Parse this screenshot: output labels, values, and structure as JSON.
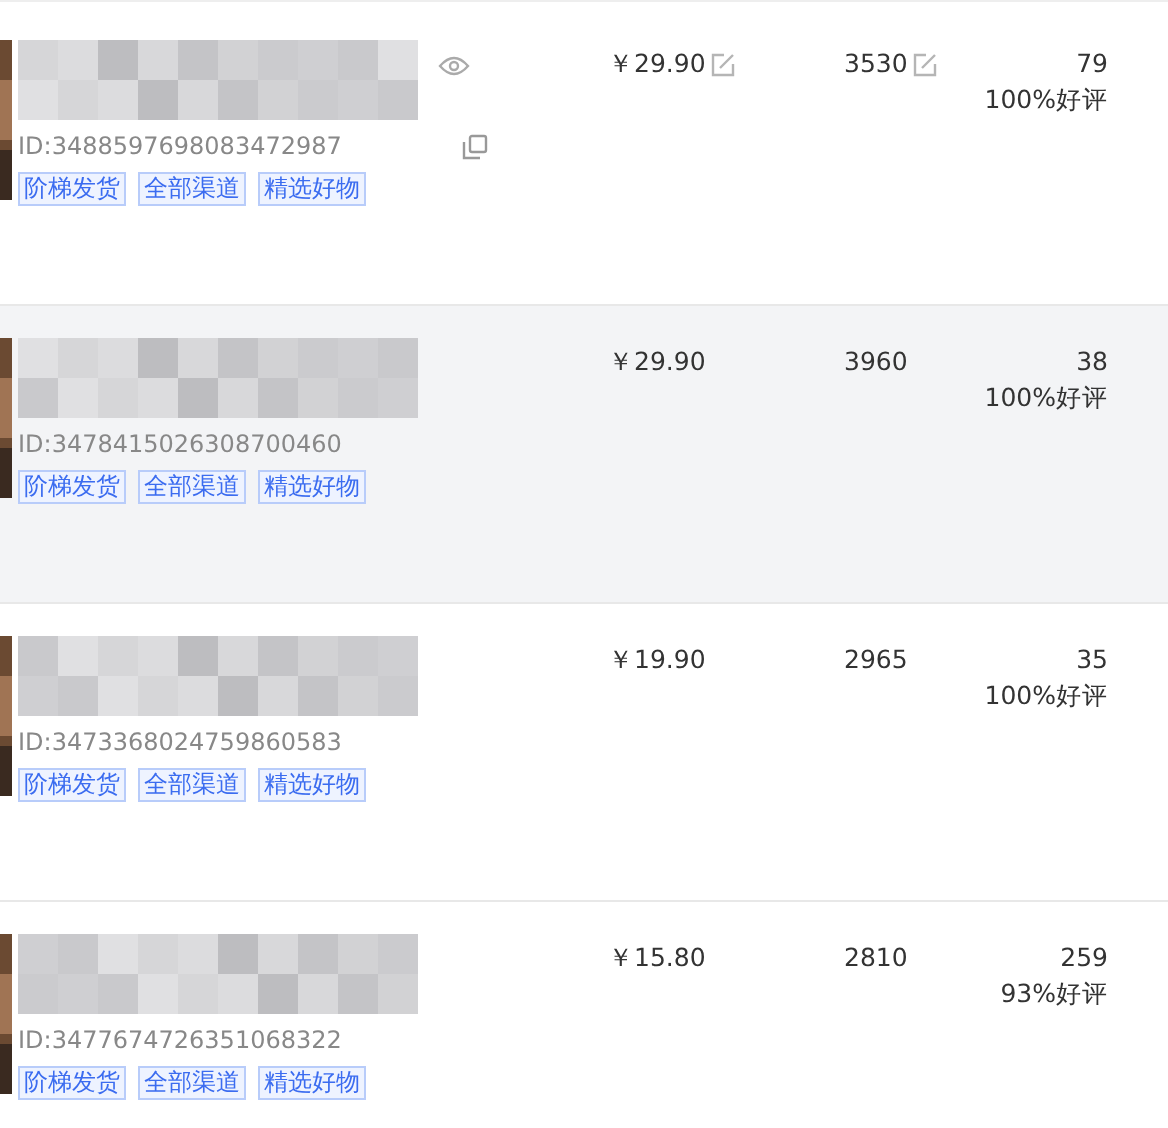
{
  "products": [
    {
      "highlighted": false,
      "editable": true,
      "id": "ID:3488597698083472987",
      "tags": [
        "阶梯发货",
        "全部渠道",
        "精选好物"
      ],
      "price": "￥29.90",
      "stock": "3530",
      "reviews": "79",
      "rating": "100%好评"
    },
    {
      "highlighted": true,
      "editable": false,
      "id": "ID:3478415026308700460",
      "tags": [
        "阶梯发货",
        "全部渠道",
        "精选好物"
      ],
      "price": "￥29.90",
      "stock": "3960",
      "reviews": "38",
      "rating": "100%好评"
    },
    {
      "highlighted": false,
      "editable": false,
      "id": "ID:3473368024759860583",
      "tags": [
        "阶梯发货",
        "全部渠道",
        "精选好物"
      ],
      "price": "￥19.90",
      "stock": "2965",
      "reviews": "35",
      "rating": "100%好评"
    },
    {
      "highlighted": false,
      "editable": false,
      "id": "ID:3477674726351068322",
      "tags": [
        "阶梯发货",
        "全部渠道",
        "精选好物"
      ],
      "price": "￥15.80",
      "stock": "2810",
      "reviews": "259",
      "rating": "93%好评"
    }
  ]
}
